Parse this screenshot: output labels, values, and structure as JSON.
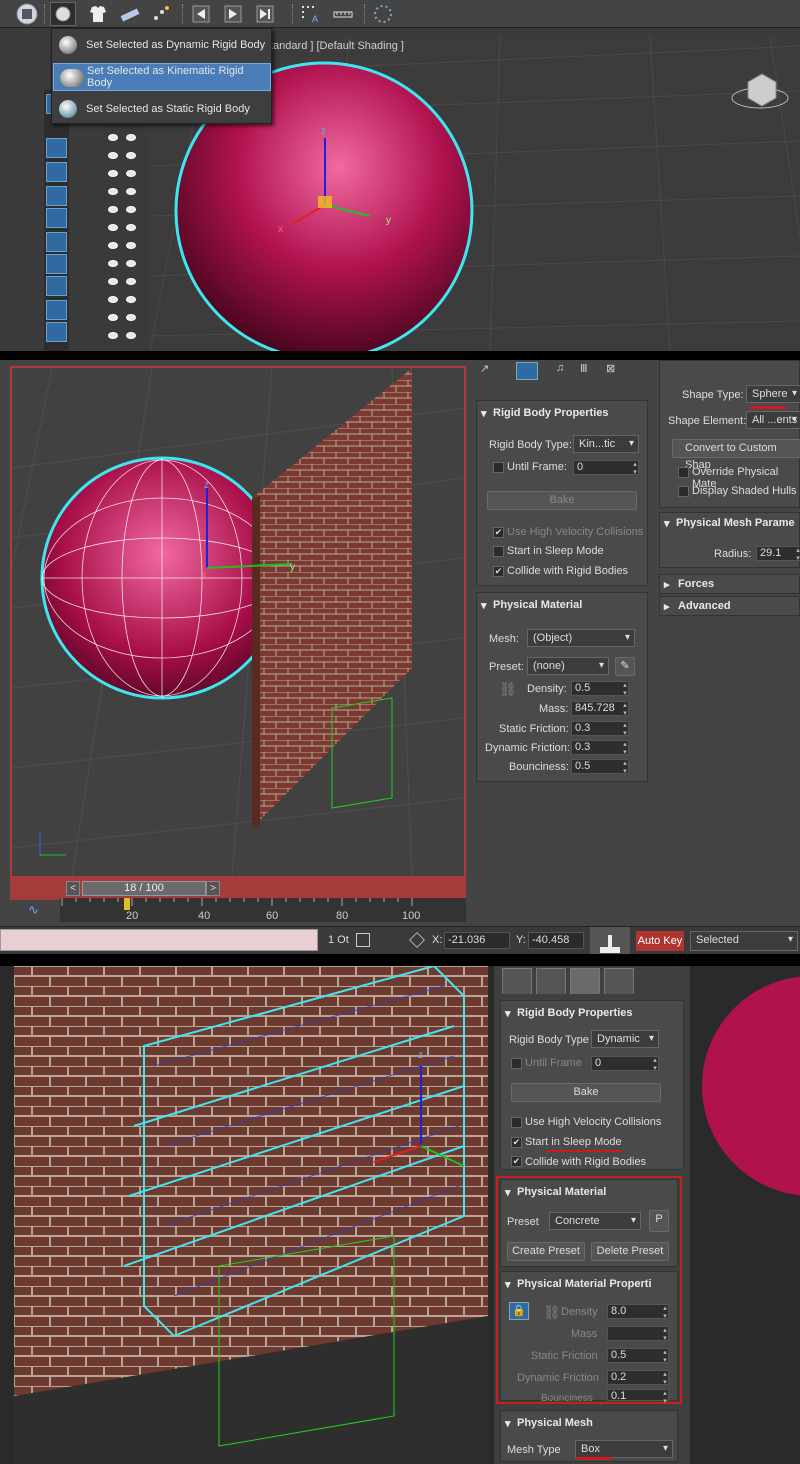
{
  "section1": {
    "viewport_label": "tandard ] [Default Shading ]",
    "flyout": [
      {
        "label": "Set Selected as Dynamic Rigid Body"
      },
      {
        "label": "Set Selected as Kinematic Rigid Body"
      },
      {
        "label": "Set Selected as Static Rigid Body"
      }
    ],
    "gizmo": {
      "z": "z",
      "y": "y",
      "x": "x"
    }
  },
  "section2": {
    "gizmo": {
      "z": "z",
      "y": "y",
      "x": "x"
    },
    "time_slider": "18 / 100",
    "time_prev": "<",
    "time_next": ">",
    "ruler_labels": [
      "20",
      "40",
      "60",
      "80",
      "100"
    ],
    "status": {
      "frames": "1 Ot",
      "x_label": "X:",
      "x_value": "-21.036",
      "y_label": "Y:",
      "y_value": "-40.458",
      "auto_key": "Auto Key",
      "selected": "Selected"
    },
    "rigid_body": {
      "title": "Rigid Body Properties",
      "type_label": "Rigid Body Type:",
      "type_value": "Kin...tic",
      "until_frame_label": "Until Frame:",
      "until_frame_value": "0",
      "bake": "Bake",
      "high_velocity": "Use High Velocity Collisions",
      "sleep_mode": "Start in Sleep Mode",
      "collide": "Collide with Rigid Bodies"
    },
    "physical_material": {
      "title": "Physical Material",
      "mesh_label": "Mesh:",
      "mesh_value": "(Object)",
      "preset_label": "Preset:",
      "preset_value": "(none)",
      "density_label": "Density:",
      "density_value": "0.5",
      "mass_label": "Mass:",
      "mass_value": "845.728",
      "static_friction_label": "Static Friction:",
      "static_friction_value": "0.3",
      "dynamic_friction_label": "Dynamic Friction:",
      "dynamic_friction_value": "0.3",
      "bounciness_label": "Bounciness:",
      "bounciness_value": "0.5"
    },
    "shape": {
      "shape_type_label": "Shape Type:",
      "shape_type_value": "Sphere",
      "shape_element_label": "Shape Element:",
      "shape_element_value": "All ...ents",
      "convert": "Convert to Custom Shap",
      "override": "Override Physical Mate",
      "display_hulls": "Display Shaded Hulls",
      "mesh_params_title": "Physical Mesh Parame",
      "radius_label": "Radius:",
      "radius_value": "29.1",
      "forces": "Forces",
      "advanced": "Advanced"
    }
  },
  "section3": {
    "gizmo": {
      "z": "z"
    },
    "rigid_body": {
      "title": "Rigid Body Properties",
      "type_label": "Rigid Body Type",
      "type_value": "Dynamic",
      "until_frame_label": "Until Frame",
      "until_frame_value": "0",
      "bake": "Bake",
      "high_velocity": "Use High Velocity Collisions",
      "sleep_mode": "Start in Sleep Mode",
      "collide": "Collide with Rigid Bodies"
    },
    "physical_material": {
      "title": "Physical Material",
      "preset_label": "Preset",
      "preset_value": "Concrete",
      "p_button": "P",
      "create_preset": "Create Preset",
      "delete_preset": "Delete Preset"
    },
    "material_properties": {
      "title": "Physical Material Properti",
      "density_label": "Density",
      "density_value": "8.0",
      "mass_label": "Mass",
      "static_friction_label": "Static Friction",
      "static_friction_value": "0.5",
      "dynamic_friction_label": "Dynamic Friction",
      "dynamic_friction_value": "0.2",
      "bounciness_label": "Bounciness",
      "bounciness_value": "0.1"
    },
    "physical_mesh": {
      "title": "Physical Mesh",
      "mesh_type_label": "Mesh Type",
      "mesh_type_value": "Box"
    }
  },
  "colors": {
    "selection_cyan": "#3ee6f0",
    "ball_magenta": "#c2185b",
    "highlight_red": "#c81e1e",
    "menu_select": "#4a7cb8"
  }
}
